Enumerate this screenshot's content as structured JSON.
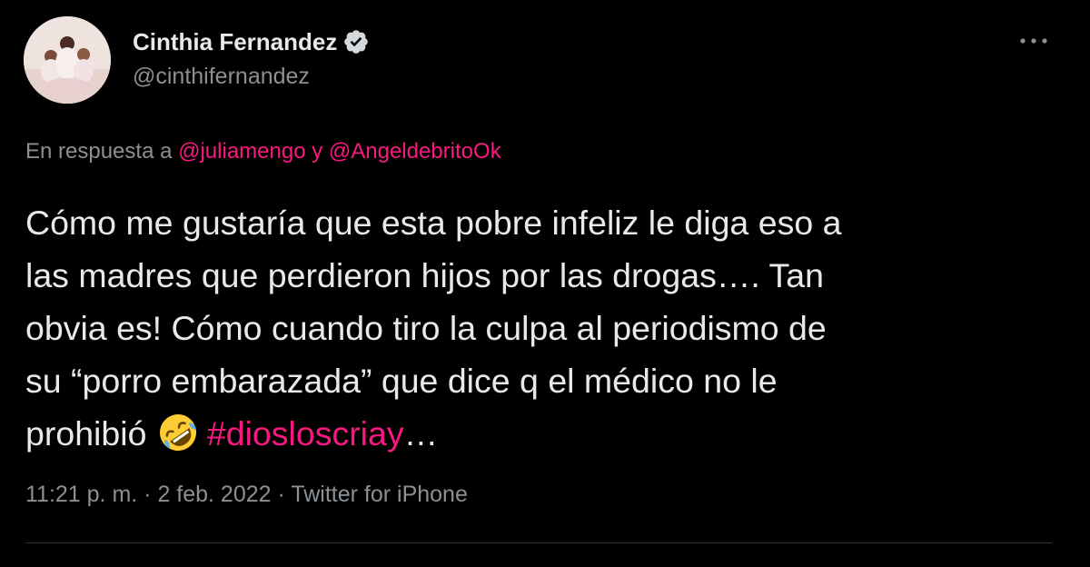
{
  "author": {
    "display_name": "Cinthia Fernandez",
    "handle": "@cinthifernandez",
    "verified": true
  },
  "reply_to": {
    "prefix": "En respuesta a ",
    "mention1": "@juliamengo",
    "connector": " y ",
    "mention2": "@AngeldebritoOk"
  },
  "tweet": {
    "line1": "Cómo me gustaría que esta pobre infeliz le diga eso a",
    "line2": "las madres que perdieron hijos por las drogas…. Tan",
    "line3": "obvia es!  Cómo cuando tiro la culpa al periodismo de",
    "line4": "su “porro embarazada” que dice q el médico no le",
    "line5_text": "prohibió ",
    "line5_emoji": "rolling-on-floor-laughing-emoji",
    "line5_hashtag": "#diosloscriay",
    "line5_ellipsis": "…"
  },
  "meta": {
    "time": "11:21 p. m.",
    "separator1": " · ",
    "date": "2 feb. 2022",
    "separator2": " · ",
    "source": "Twitter for iPhone"
  },
  "colors": {
    "background": "#000000",
    "text": "#e7e9ea",
    "secondary": "#8b9094",
    "accent": "#f91880",
    "verified": "#d6d9db",
    "divider": "#2f3336"
  },
  "icons": {
    "verified": "verified-badge-icon",
    "more": "more-options-icon"
  }
}
